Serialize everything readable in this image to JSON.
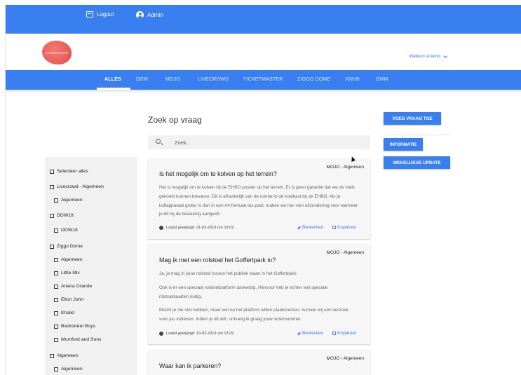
{
  "topbar": {
    "logout": "Logout",
    "admin": "Admin"
  },
  "brand": {
    "logo_text": "LIVE CROWD",
    "welcome": "Welkom Arwind"
  },
  "nav": {
    "items": [
      "ALLES",
      "DDW",
      "MOJO",
      "LIVECROWD",
      "TICKETMASTER",
      "ZIGGO DOME",
      "KNVB",
      "GMM"
    ],
    "active": "ALLES"
  },
  "main": {
    "title": "Zoek op vraag",
    "search_placeholder": "Zoek.."
  },
  "filters": [
    "Selecteer alles",
    "Livecrowd - Algemeen",
    "Algemeen",
    "DDW18",
    "DDW18",
    "Ziggo Dome",
    "Algemeen",
    "Little Mix",
    "Ariana Grande",
    "Elton John",
    "Khalid",
    "Backstreet Boys",
    "Mumford and Sons",
    "Algemeen",
    "Algemeen"
  ],
  "cards": [
    {
      "category": "MOJO - Algemeen",
      "question": "Is het mogelijk om te kolven op het terrein?",
      "answer": [
        "Het is mogelijk om te kolven bij de EHBO posten op het terrein. Er is geen garantie dat we de melk gekoeld kunnen bewaren. Dit is afhankelijk van de ruimte in de koelkast bij de EHBO. Als je kolfapparaat groter is dan in een A4 formaat tas past, maken we hier een uitzondering voor wanneer je dit bij de bewaking aangeeft."
      ],
      "updated": "Laatst gewijzigd: 21-03-2019 om 18:02",
      "edit": "Bewerken",
      "copy": "Kopiëren"
    },
    {
      "category": "MOJO - Algemeen",
      "question": "Mag ik met een rolstoel het Goffertpark in?",
      "answer": [
        "Ja, je mag in jouw rolstoel tussen het publiek staan in het Goffertpark.",
        "Ook is er een speciaal rolstoelplatform aanwezig. Hiervoor heb je echter wel speciale rolstoelkaarten nodig.",
        "Mocht je die niet hebben, maar wel op het platform willen plaatsnemen, kunnen wij een verzoek voor jou indienen. Indien je dit wilt, ontvang ik graag jouw ordernummer."
      ],
      "updated": "Laatst gewijzigd: 19-02-2019 om 13:29",
      "edit": "Bewerken",
      "copy": "Kopiëren"
    },
    {
      "category": "MOJO - Algemeen",
      "question": "Waar kan ik parkeren?"
    }
  ],
  "actions": {
    "add": "VOEG VRAAG TOE",
    "info": "INFORMATIE",
    "weekly": "WEKELIJKSE UPDATE"
  },
  "colors": {
    "primary": "#3a7ff0",
    "logo": "#e24e52"
  }
}
